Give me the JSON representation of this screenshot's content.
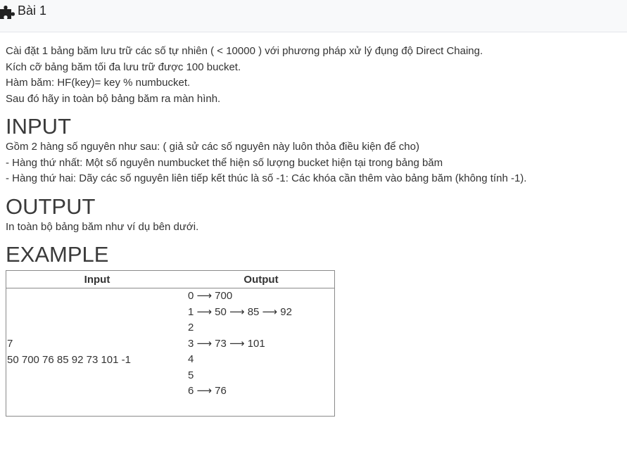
{
  "header": {
    "title": "Bài 1",
    "icon": "puzzle-icon"
  },
  "description": [
    "Cài đặt 1 bảng băm lưu trữ các số tự nhiên ( < 10000 ) với phương pháp xử lý đụng độ Direct Chaing.",
    "Kích cỡ bảng băm tối đa lưu trữ được 100 bucket.",
    "Hàm băm: HF(key)= key % numbucket.",
    "Sau đó hãy in toàn bộ bảng băm ra màn hình."
  ],
  "input_section": {
    "heading": "INPUT",
    "lines": [
      "Gồm 2 hàng số nguyên như sau: ( giả sử các số nguyên này luôn thỏa điều kiện để cho)",
      "- Hàng thứ nhất: Một số nguyên numbucket thể hiện số lượng bucket hiện tại trong bảng băm",
      "- Hàng thứ hai: Dãy các số nguyên liên tiếp kết thúc là số -1: Các khóa cần thêm vào bảng băm (không tính -1)."
    ]
  },
  "output_section": {
    "heading": "OUTPUT",
    "lines": [
      "In toàn bộ bảng băm như ví dụ bên dưới."
    ]
  },
  "example_section": {
    "heading": "EXAMPLE",
    "table": {
      "headers": [
        "Input",
        "Output"
      ],
      "input_lines": [
        "7",
        "50 700 76 85 92 73 101 -1"
      ],
      "output_lines": [
        "0 ⟶ 700",
        "1 ⟶ 50 ⟶ 85 ⟶ 92",
        "2",
        "3 ⟶ 73 ⟶ 101",
        "4",
        "5",
        "6 ⟶ 76"
      ]
    }
  }
}
